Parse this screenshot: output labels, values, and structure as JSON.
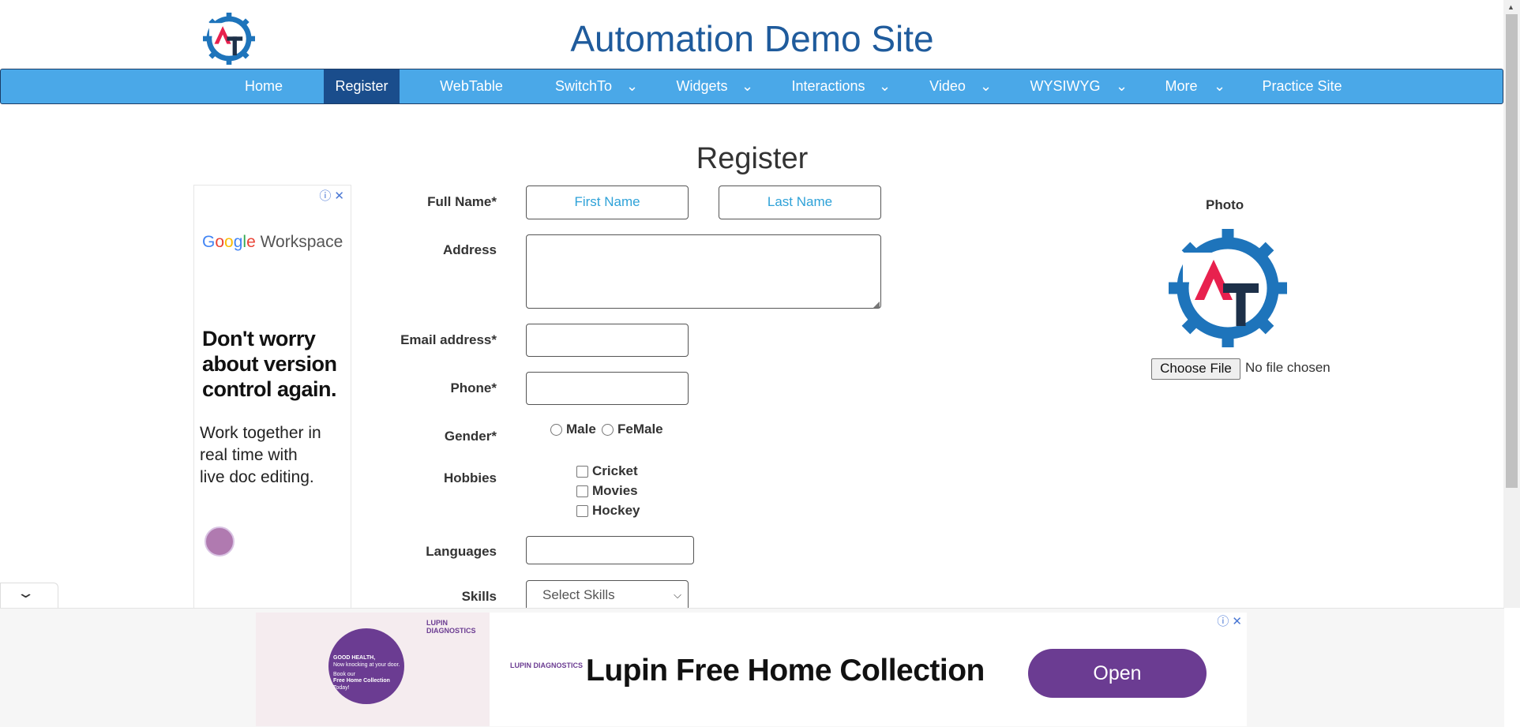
{
  "header": {
    "site_title": "Automation Demo Site"
  },
  "nav": {
    "items": [
      {
        "label": "Home"
      },
      {
        "label": "Register"
      },
      {
        "label": "WebTable"
      },
      {
        "label": "SwitchTo"
      },
      {
        "label": "Widgets"
      },
      {
        "label": "Interactions"
      },
      {
        "label": "Video"
      },
      {
        "label": "WYSIWYG"
      },
      {
        "label": "More"
      },
      {
        "label": "Practice Site"
      }
    ],
    "active": "Register"
  },
  "side_ad": {
    "brand": "Google Workspace",
    "headline": "Don't worry about version control again.",
    "body": "Work together in real time with live doc editing."
  },
  "form": {
    "heading": "Register",
    "full_name_label": "Full Name*",
    "first_name_placeholder": "First Name",
    "last_name_placeholder": "Last Name",
    "address_label": "Address",
    "email_label": "Email address*",
    "phone_label": "Phone*",
    "gender_label": "Gender*",
    "gender_options": [
      "Male",
      "FeMale"
    ],
    "hobbies_label": "Hobbies",
    "hobbies": [
      "Cricket",
      "Movies",
      "Hockey"
    ],
    "languages_label": "Languages",
    "skills_label": "Skills",
    "skills_selected": "Select Skills"
  },
  "photo": {
    "label": "Photo",
    "choose_file_label": "Choose File",
    "no_file_text": "No file chosen"
  },
  "bottom_ad": {
    "image_text": {
      "circle_lines": [
        "GOOD HEALTH,",
        "Now knocking at your door.",
        "Book our",
        "Free Home Collection",
        "Today!"
      ],
      "brand": "LUPIN DIAGNOSTICS"
    },
    "headline": "Lupin Free Home Collection",
    "cta": "Open"
  },
  "colors": {
    "nav_bg": "#4aa8e8",
    "nav_active": "#1a4d8c",
    "title": "#1f5b9c",
    "ad_purple": "#6b3c92"
  }
}
